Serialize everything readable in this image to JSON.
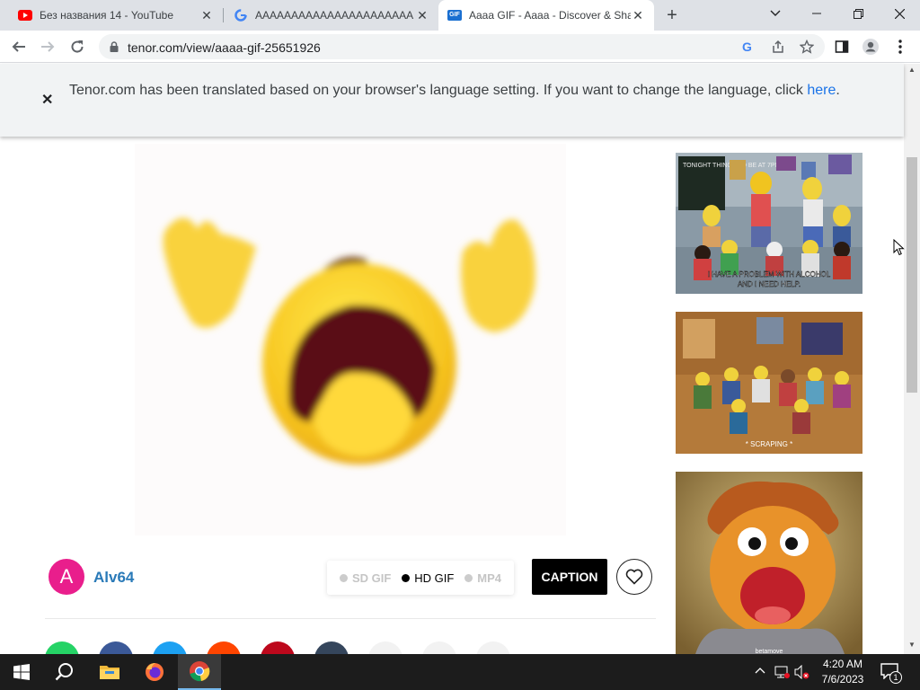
{
  "browser": {
    "tabs": [
      {
        "title": "Без названия 14 - YouTube",
        "favicon": "youtube-icon",
        "active": false
      },
      {
        "title": "AAAAAAAAAAAAAAAAAAAAAA",
        "favicon": "google-icon",
        "active": false
      },
      {
        "title": "Aaaa GIF - Aaaa - Discover & Sha",
        "favicon": "gif-icon",
        "favicon_text": "GIF",
        "active": true
      }
    ],
    "url": "tenor.com/view/aaaa-gif-25651926"
  },
  "banner": {
    "text": "Tenor.com has been translated based on your browser's language setting. If you want to change the language, click ",
    "link": "here",
    "suffix": "."
  },
  "gif": {
    "author_initial": "A",
    "author_name": "Alv64",
    "formats": [
      {
        "label": "SD GIF",
        "active": false
      },
      {
        "label": "HD GIF",
        "active": true
      },
      {
        "label": "MP4",
        "active": false
      }
    ],
    "caption_label": "CAPTION"
  },
  "related": [
    {
      "subject": "simpsons-support-group",
      "caption": "I HAVE A PROBLEM WITH ALCOHOL AND I NEED HELP.",
      "board_text": "TONIGHT THINGS TO BE AT 7PM"
    },
    {
      "subject": "simpsons-meeting",
      "caption": "* SCRAPING *"
    },
    {
      "subject": "muppet-screaming",
      "caption": "betamove"
    }
  ],
  "share_colors": [
    "#25d366",
    "#3b5998",
    "#1da1f2",
    "#ff4500",
    "#bd081c",
    "#35465c",
    "#f2f2f2",
    "#f2f2f2",
    "#f2f2f2"
  ],
  "taskbar": {
    "time": "4:20 AM",
    "date": "7/6/2023",
    "notification_count": "1"
  }
}
